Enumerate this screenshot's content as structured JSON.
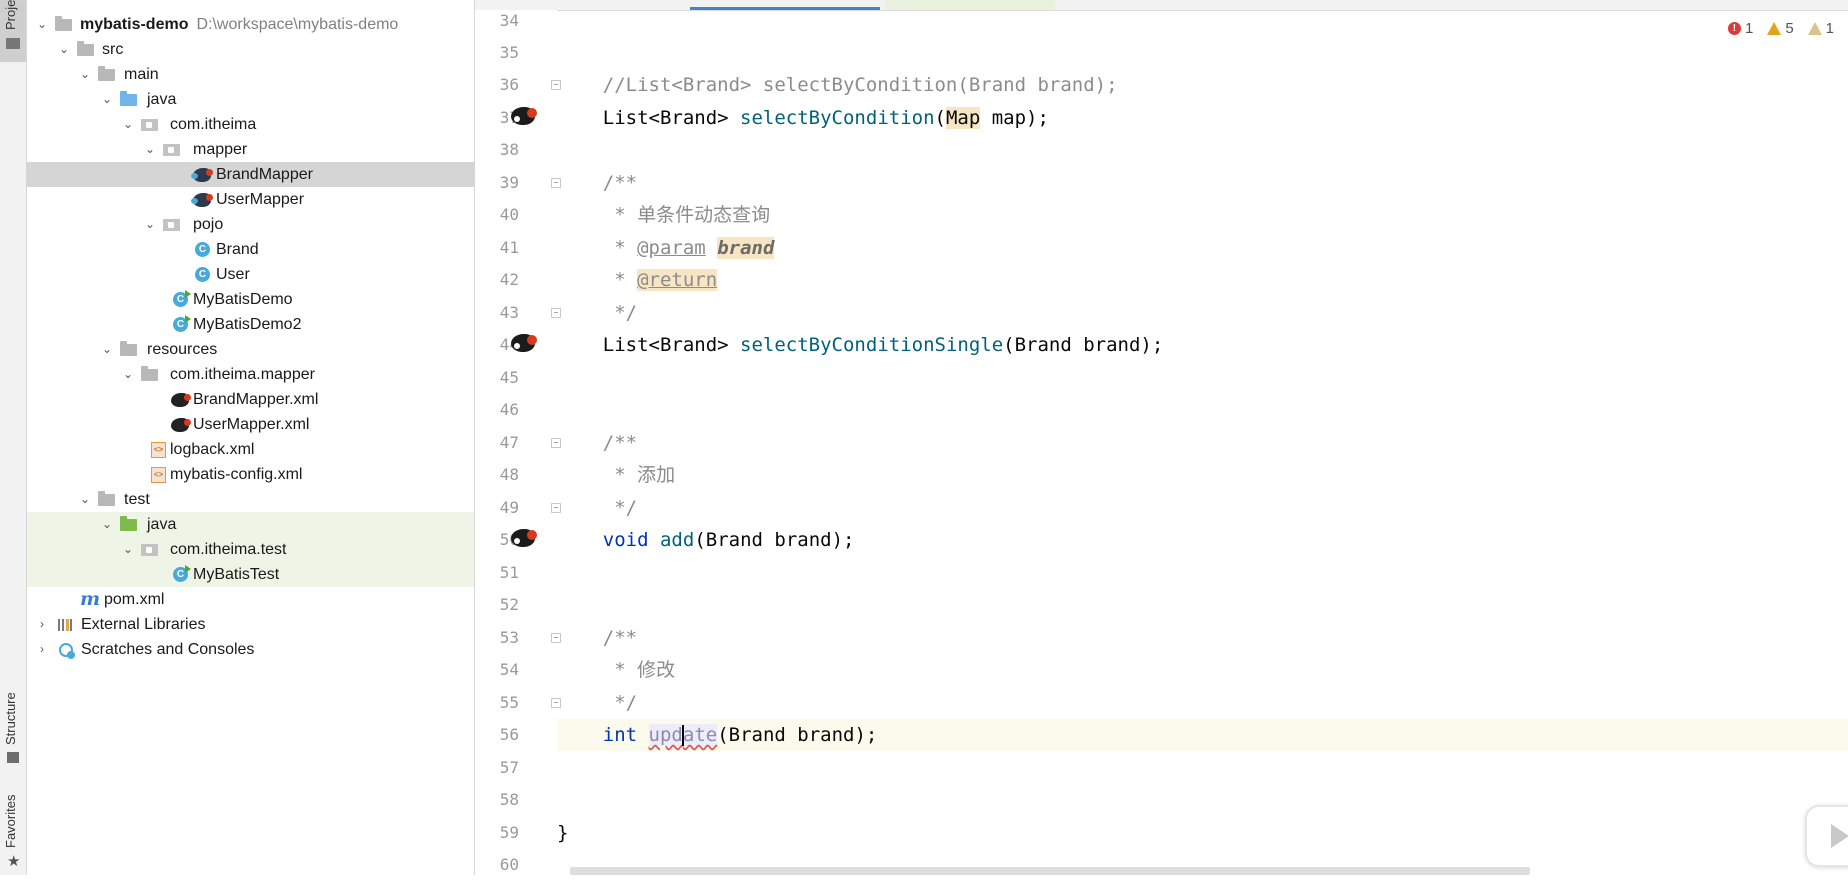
{
  "window": {
    "tool_strip": {
      "project": "Proje",
      "structure": "Structure",
      "favorites": "Favorites"
    }
  },
  "project_tree": {
    "root": {
      "name": "mybatis-demo",
      "path": "D:\\workspace\\mybatis-demo"
    },
    "items": [
      {
        "label": "src"
      },
      {
        "label": "main"
      },
      {
        "label": "java"
      },
      {
        "label": "com.itheima"
      },
      {
        "label": "mapper"
      },
      {
        "label": "BrandMapper"
      },
      {
        "label": "UserMapper"
      },
      {
        "label": "pojo"
      },
      {
        "label": "Brand"
      },
      {
        "label": "User"
      },
      {
        "label": "MyBatisDemo"
      },
      {
        "label": "MyBatisDemo2"
      },
      {
        "label": "resources"
      },
      {
        "label": "com.itheima.mapper"
      },
      {
        "label": "BrandMapper.xml"
      },
      {
        "label": "UserMapper.xml"
      },
      {
        "label": "logback.xml"
      },
      {
        "label": "mybatis-config.xml"
      },
      {
        "label": "test"
      },
      {
        "label": "java"
      },
      {
        "label": "com.itheima.test"
      },
      {
        "label": "MyBatisTest"
      },
      {
        "label": "pom.xml"
      },
      {
        "label": "External Libraries"
      },
      {
        "label": "Scratches and Consoles"
      }
    ],
    "class_badge": "C"
  },
  "inspections": {
    "errors": "1",
    "warnings": "5",
    "weak_warnings": "1"
  },
  "editor": {
    "line_numbers": [
      "34",
      "35",
      "36",
      "37",
      "38",
      "39",
      "40",
      "41",
      "42",
      "43",
      "44",
      "45",
      "46",
      "47",
      "48",
      "49",
      "50",
      "51",
      "52",
      "53",
      "54",
      "55",
      "56",
      "57",
      "58",
      "59",
      "60"
    ],
    "code": {
      "l36": "//List<Brand> selectByCondition(Brand brand);",
      "l37_type": "List<Brand> ",
      "l37_fn": "selectByCondition",
      "l37_open": "(",
      "l37_map": "Map",
      "l37_rest": " map);",
      "l39": "/**",
      "l40": " * 单条件动态查询",
      "l41_star": " * ",
      "l41_tag": "@param",
      "l41_space": " ",
      "l41_param": "brand",
      "l42_star": " * ",
      "l42_tag": "@return",
      "l43": " */",
      "l44_type": "List<Brand> ",
      "l44_fn": "selectByConditionSingle",
      "l44_rest": "(Brand brand);",
      "l47": "/**",
      "l48": " * 添加",
      "l49": " */",
      "l50_kw": "void",
      "l50_sp": " ",
      "l50_fn": "add",
      "l50_rest": "(Brand brand);",
      "l53": "/**",
      "l54": " * 修改",
      "l55": " */",
      "l56_kw": "int",
      "l56_sp": " ",
      "l56_fn_a": "upd",
      "l56_fn_b": "ate",
      "l56_rest": "(Brand brand);",
      "l59": "}"
    }
  }
}
